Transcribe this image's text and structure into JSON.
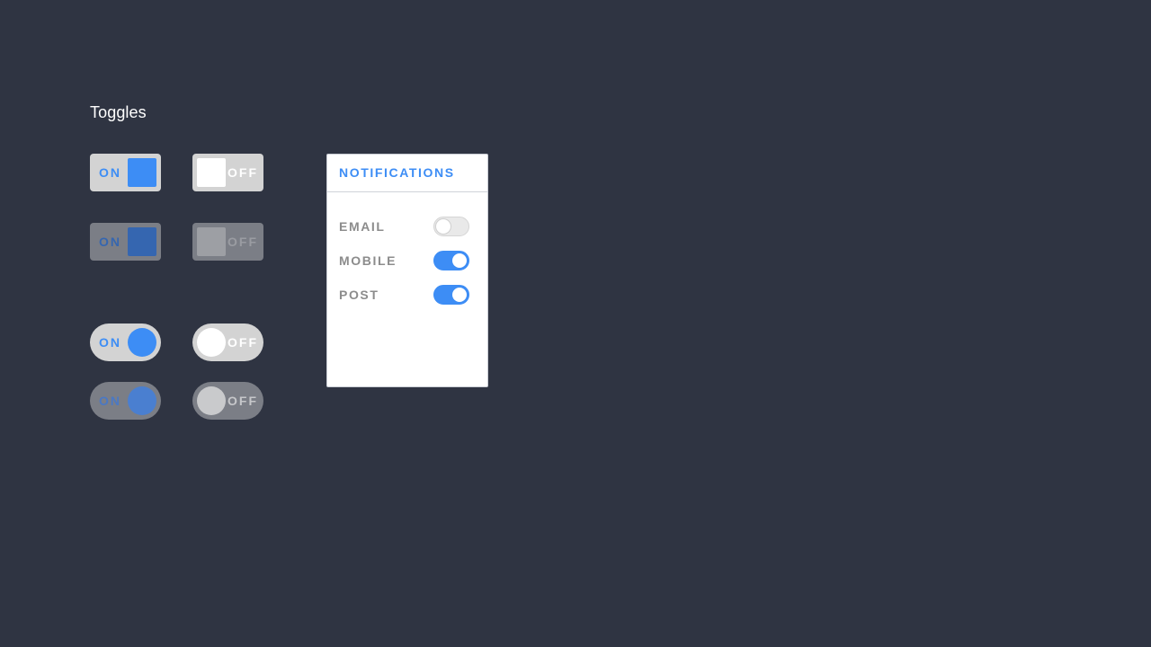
{
  "section": {
    "title": "Toggles"
  },
  "toggles": {
    "square_on": {
      "label": "ON",
      "state": "on",
      "disabled": false
    },
    "square_off": {
      "label": "OFF",
      "state": "off",
      "disabled": false
    },
    "square_on_disabled": {
      "label": "ON",
      "state": "on",
      "disabled": true
    },
    "square_off_disabled": {
      "label": "OFF",
      "state": "off",
      "disabled": true
    },
    "round_on": {
      "label": "ON",
      "state": "on",
      "disabled": false
    },
    "round_off": {
      "label": "OFF",
      "state": "off",
      "disabled": false
    },
    "round_on_disabled": {
      "label": "ON",
      "state": "on",
      "disabled": true
    },
    "round_off_disabled": {
      "label": "OFF",
      "state": "off",
      "disabled": true
    }
  },
  "notifications": {
    "title": "NOTIFICATIONS",
    "items": [
      {
        "label": "EMAIL",
        "enabled": false
      },
      {
        "label": "MOBILE",
        "enabled": true
      },
      {
        "label": "POST",
        "enabled": true
      }
    ]
  },
  "colors": {
    "background": "#2f3442",
    "accent": "#3d8df5",
    "toggle_track": "#d3d3d3",
    "toggle_track_disabled": "#7b7e86",
    "card_background": "#ffffff",
    "label_gray": "#8c8c8c"
  }
}
